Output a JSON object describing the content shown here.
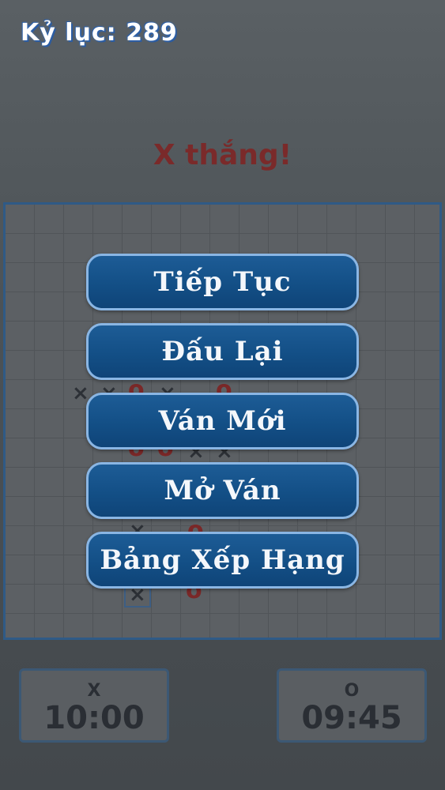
{
  "header": {
    "record": "Kỷ lục: 289"
  },
  "game": {
    "result": "X thắng!"
  },
  "menu": {
    "continue": "Tiếp Tục",
    "rematch": "Đấu Lại",
    "new_game": "Ván Mới",
    "open_game": "Mở Ván",
    "leaderboard": "Bảng Xếp Hạng"
  },
  "players": {
    "x": {
      "symbol": "X",
      "time": "10:00"
    },
    "o": {
      "symbol": "O",
      "time": "09:45"
    }
  },
  "colors": {
    "button_fill": "#134f86",
    "button_border": "#8ab6e4",
    "result_text": "#7a2a2a",
    "record_glow": "#2a5aa0"
  }
}
